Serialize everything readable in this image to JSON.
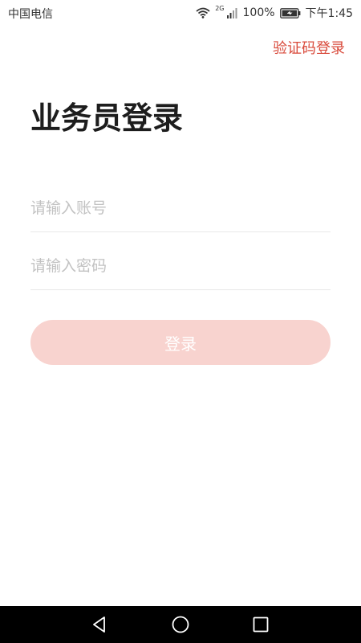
{
  "status_bar": {
    "carrier": "中国电信",
    "network_type": "2G",
    "battery": "100%",
    "time": "下午1:45"
  },
  "header": {
    "alt_login_label": "验证码登录"
  },
  "page": {
    "title": "业务员登录"
  },
  "form": {
    "account_placeholder": "请输入账号",
    "account_value": "",
    "password_placeholder": "请输入密码",
    "password_value": "",
    "login_label": "登录"
  },
  "colors": {
    "accent": "#d94a3b",
    "button_bg": "#f8d3cf",
    "title": "#1d1d1d",
    "placeholder": "#c2c2c2",
    "divider": "#e8e8e8",
    "nav_bar": "#000000"
  },
  "icons": {
    "wifi": "wifi-icon",
    "signal": "signal-icon",
    "battery": "battery-icon",
    "back": "back-triangle-icon",
    "home": "home-circle-icon",
    "recent": "recent-square-icon"
  }
}
